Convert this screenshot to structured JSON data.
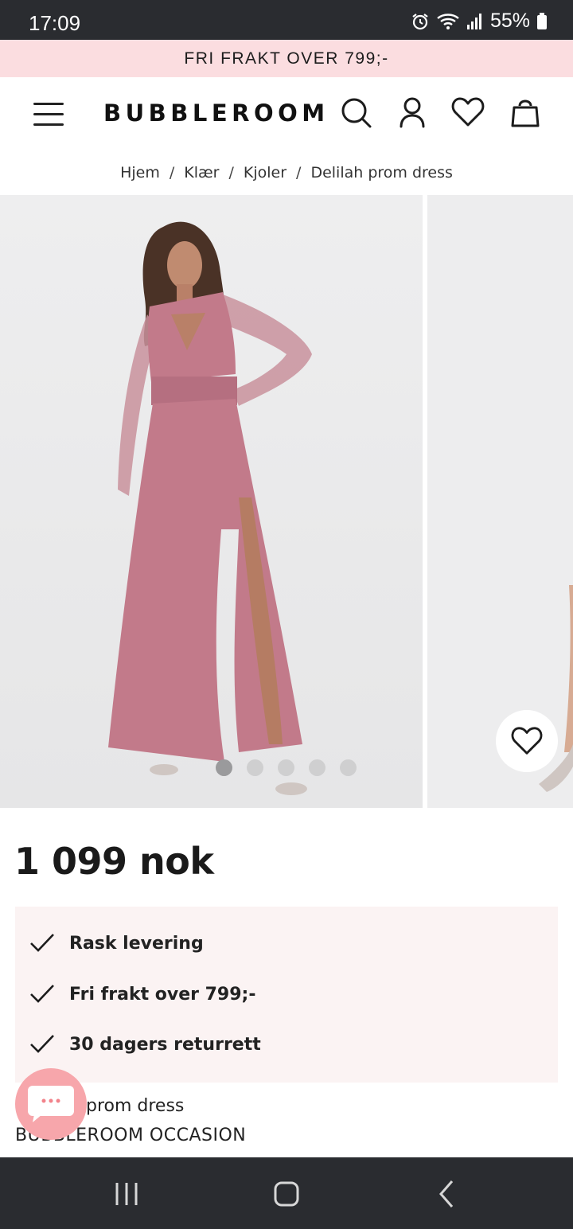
{
  "status_bar": {
    "time": "17:09",
    "battery": "55%",
    "icons": [
      "alarm-icon",
      "wifi-icon",
      "signal-icon",
      "battery-icon"
    ]
  },
  "promo": {
    "text": "FRI FRAKT OVER 799;-"
  },
  "header": {
    "logo": "BUBBLEROOM",
    "icons": [
      "menu-icon",
      "search-icon",
      "account-icon",
      "wishlist-icon",
      "bag-icon"
    ]
  },
  "breadcrumb": {
    "items": [
      "Hjem",
      "Klær",
      "Kjoler",
      "Delilah prom dress"
    ]
  },
  "gallery": {
    "total_images": 5,
    "active_index": 0,
    "dress_color": "#c27a8a"
  },
  "product": {
    "price": "1 099 nok",
    "name_visible": "prom dress",
    "brand": "BUBBLEROOM OCCASION"
  },
  "usps": [
    "Rask levering",
    "Fri frakt over 799;-",
    "30 dagers returrett"
  ],
  "colors": {
    "promo_bg": "#fbdde0",
    "usp_bg": "#fbf3f3",
    "chat_button": "#f7a6ab",
    "system_bar": "#2a2c30"
  }
}
